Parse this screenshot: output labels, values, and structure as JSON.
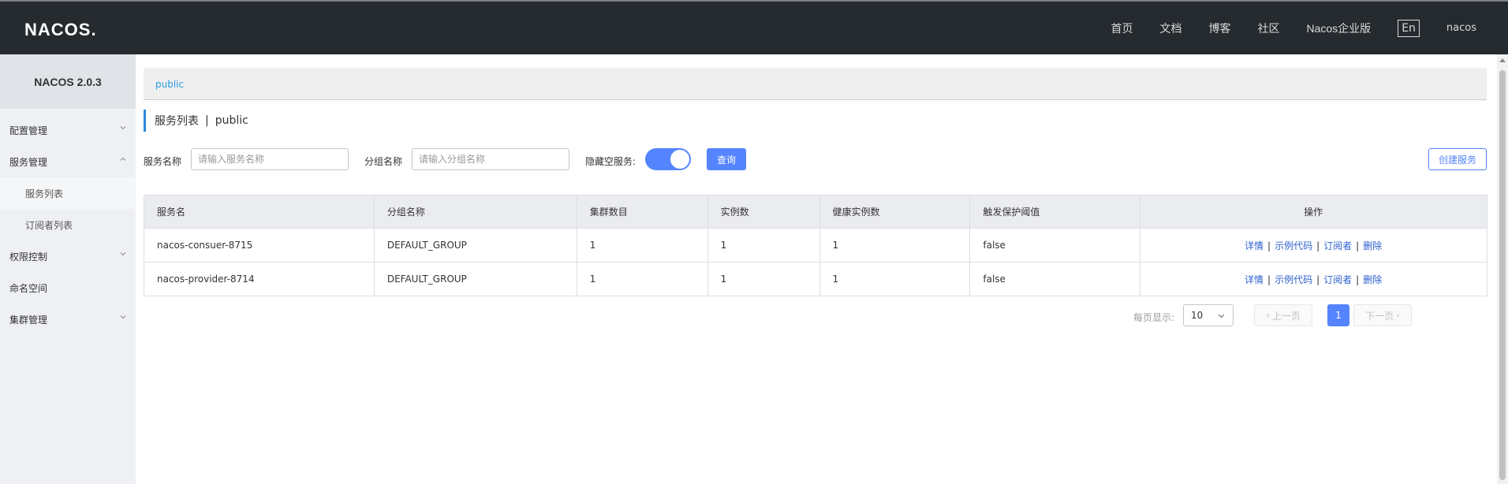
{
  "header": {
    "logo": "NACOS.",
    "nav": [
      "首页",
      "文档",
      "博客",
      "社区",
      "Nacos企业版"
    ],
    "lang": "En",
    "user": "nacos"
  },
  "sidebar": {
    "title": "NACOS 2.0.3",
    "items": [
      {
        "label": "配置管理",
        "expanded": false
      },
      {
        "label": "服务管理",
        "expanded": true
      },
      {
        "label": "服务列表",
        "sub": true,
        "active": true
      },
      {
        "label": "订阅者列表",
        "sub": true
      },
      {
        "label": "权限控制",
        "expanded": false
      },
      {
        "label": "命名空间"
      },
      {
        "label": "集群管理",
        "expanded": false
      }
    ]
  },
  "namespace": "public",
  "page": {
    "title": "服务列表",
    "separator": "|",
    "namespace": "public"
  },
  "filters": {
    "service_label": "服务名称",
    "service_placeholder": "请输入服务名称",
    "group_label": "分组名称",
    "group_placeholder": "请输入分组名称",
    "hide_empty_label": "隐藏空服务:",
    "hide_empty_on": true,
    "search_button": "查询",
    "create_button": "创建服务"
  },
  "table": {
    "columns": [
      "服务名",
      "分组名称",
      "集群数目",
      "实例数",
      "健康实例数",
      "触发保护阈值",
      "操作"
    ],
    "rows": [
      [
        "nacos-consuer-8715",
        "DEFAULT_GROUP",
        "1",
        "1",
        "1",
        "false"
      ],
      [
        "nacos-provider-8714",
        "DEFAULT_GROUP",
        "1",
        "1",
        "1",
        "false"
      ]
    ],
    "actions": [
      "详情",
      "示例代码",
      "订阅者",
      "删除"
    ],
    "action_separator": "|"
  },
  "pagination": {
    "per_page_label": "每页显示:",
    "per_page": "10",
    "prev": "上一页",
    "next": "下一页",
    "current": "1"
  },
  "colors": {
    "topbar": "#252a2f",
    "primary": "#5584ff",
    "link": "#2c5fcf",
    "accent": "#2c9ee0"
  }
}
